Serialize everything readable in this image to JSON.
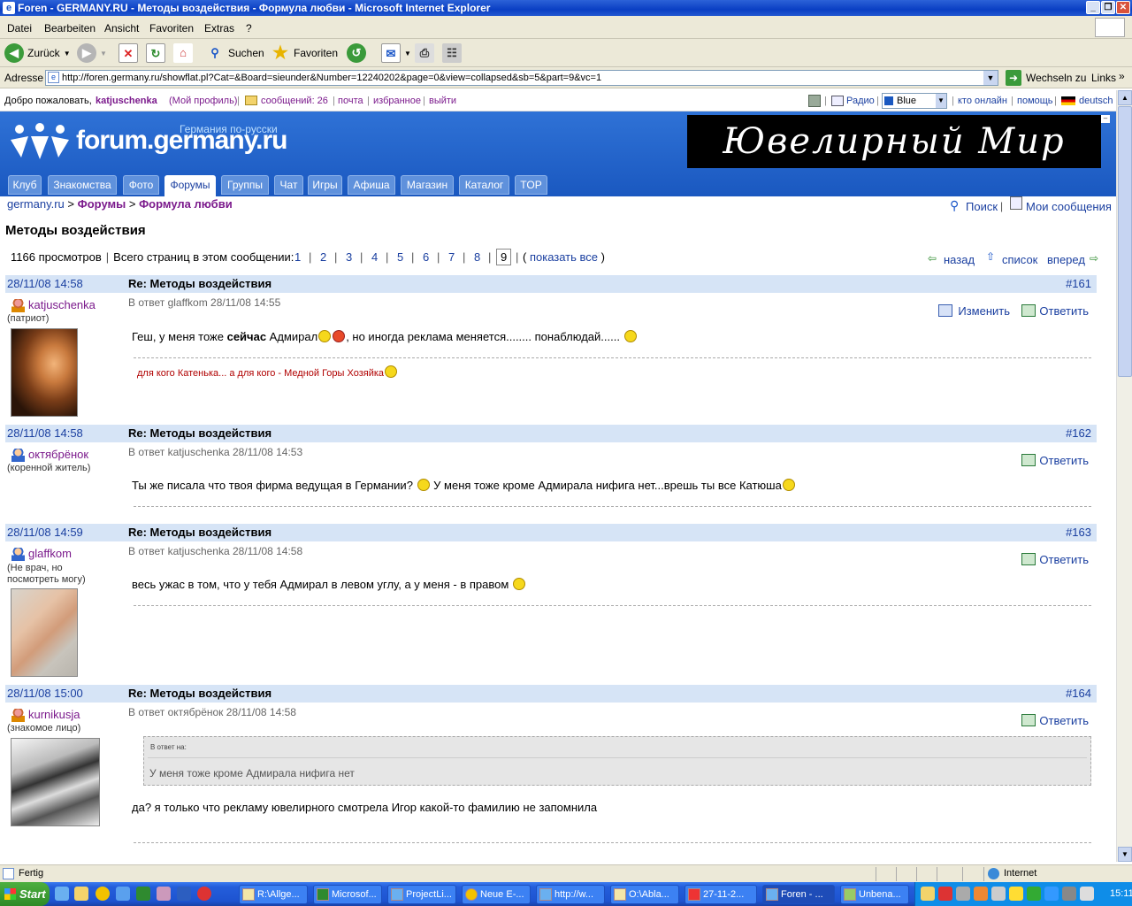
{
  "window": {
    "title": "Foren - GERMANY.RU - Методы воздействия - Формула любви - Microsoft Internet Explorer"
  },
  "menu": [
    "Datei",
    "Bearbeiten",
    "Ansicht",
    "Favoriten",
    "Extras",
    "?"
  ],
  "toolbar": {
    "back": "Zurück",
    "search": "Suchen",
    "favorites": "Favoriten"
  },
  "address": {
    "label": "Adresse",
    "url": "http://foren.germany.ru/showflat.pl?Cat=&Board=sieunder&Number=12240202&page=0&view=collapsed&sb=5&part=9&vc=1",
    "go": "Wechseln zu",
    "links": "Links"
  },
  "siteline": {
    "welcome": "Добро пожаловать,",
    "user": "katjuschenka",
    "profile": "(Мой профиль)",
    "messages": "сообщений: 26",
    "mail": "почта",
    "favorites": "избранное",
    "logout": "выйти",
    "radio": "Радио",
    "theme": "Blue",
    "online": "кто онлайн",
    "help": "помощь",
    "lang": "deutsch"
  },
  "brand": {
    "name": "forum.germany.ru",
    "tagline": "Германия по-русски",
    "banner": "Ювелирный Мир"
  },
  "nav": [
    "Клуб",
    "Знакомства",
    "Фото",
    "Форумы",
    "Группы",
    "Чат",
    "Игры",
    "Афиша",
    "Магазин",
    "Каталог",
    "TOP"
  ],
  "breadcrumb": {
    "site": "germany.ru",
    "sep1": ">",
    "forums": "Форумы",
    "sep2": ">",
    "board": "Формула любви"
  },
  "tools": {
    "search": "Поиск",
    "my": "Мои сообщения"
  },
  "thread": {
    "title": "Методы воздействия",
    "views": "1166 просмотров",
    "pages_label": "Всего страниц в этом сообщении:",
    "pages": [
      "1",
      "2",
      "3",
      "4",
      "5",
      "6",
      "7",
      "8",
      "9"
    ],
    "show_all": "показать все",
    "back": "назад",
    "list": "список",
    "forward": "вперед"
  },
  "posts": [
    {
      "date": "28/11/08 14:58",
      "subject": "Re: Методы воздействия",
      "num": "#161",
      "user": "katjuschenka",
      "rank": "(патриот)",
      "inreply": "В ответ glaffkom 28/11/08 14:55",
      "edit": "Изменить",
      "reply": "Ответить",
      "body_a": "Геш, у меня тоже ",
      "body_b": "сейчас",
      "body_c": " Адмирал",
      "body_d": ", но иногда реклама меняется........ понаблюдай...... ",
      "signature": "для кого Катенька... а для кого - Медной Горы Хозяйка"
    },
    {
      "date": "28/11/08 14:58",
      "subject": "Re: Методы воздействия",
      "num": "#162",
      "user": "октябрёнок",
      "rank": "(коренной житель)",
      "inreply": "В ответ katjuschenka 28/11/08 14:53",
      "reply": "Ответить",
      "body_a": "Ты же писала что твоя фирма ведущая в Германии? ",
      "body_b": " У меня тоже кроме Адмирала нифига нет...врешь ты все Катюша"
    },
    {
      "date": "28/11/08 14:59",
      "subject": "Re: Методы воздействия",
      "num": "#163",
      "user": "glaffkom",
      "rank": "(Не врач, но посмотреть могу)",
      "inreply": "В ответ katjuschenka 28/11/08 14:58",
      "reply": "Ответить",
      "body_a": "весь ужас в том, что у тебя Адмирал в левом углу, а у меня - в правом "
    },
    {
      "date": "28/11/08 15:00",
      "subject": "Re: Методы воздействия",
      "num": "#164",
      "user": "kurnikusja",
      "rank": "(знакомое лицо)",
      "inreply": "В ответ октябрёнок 28/11/08 14:58",
      "reply": "Ответить",
      "quote_label": "В ответ на:",
      "quote": "У меня тоже кроме Адмирала нифига нет",
      "body_a": "да? я только что рекламу ювелирного смотрела Игор какой-то фамилию не запомнила"
    }
  ],
  "status": {
    "text": "Fertig",
    "zone": "Internet"
  },
  "taskbar": {
    "start": "Start",
    "tasks": [
      "R:\\Allge...",
      "Microsof...",
      "ProjectLi...",
      "Neue E-...",
      "http://w...",
      "O:\\Abla...",
      "27-11-2...",
      "Foren - ...",
      "Unbena..."
    ],
    "clock": "15:11"
  },
  "colors": {
    "accent": "#1a58c0",
    "post_header": "#d6e4f6",
    "username": "#7b1a8c",
    "signature": "#b00000"
  }
}
